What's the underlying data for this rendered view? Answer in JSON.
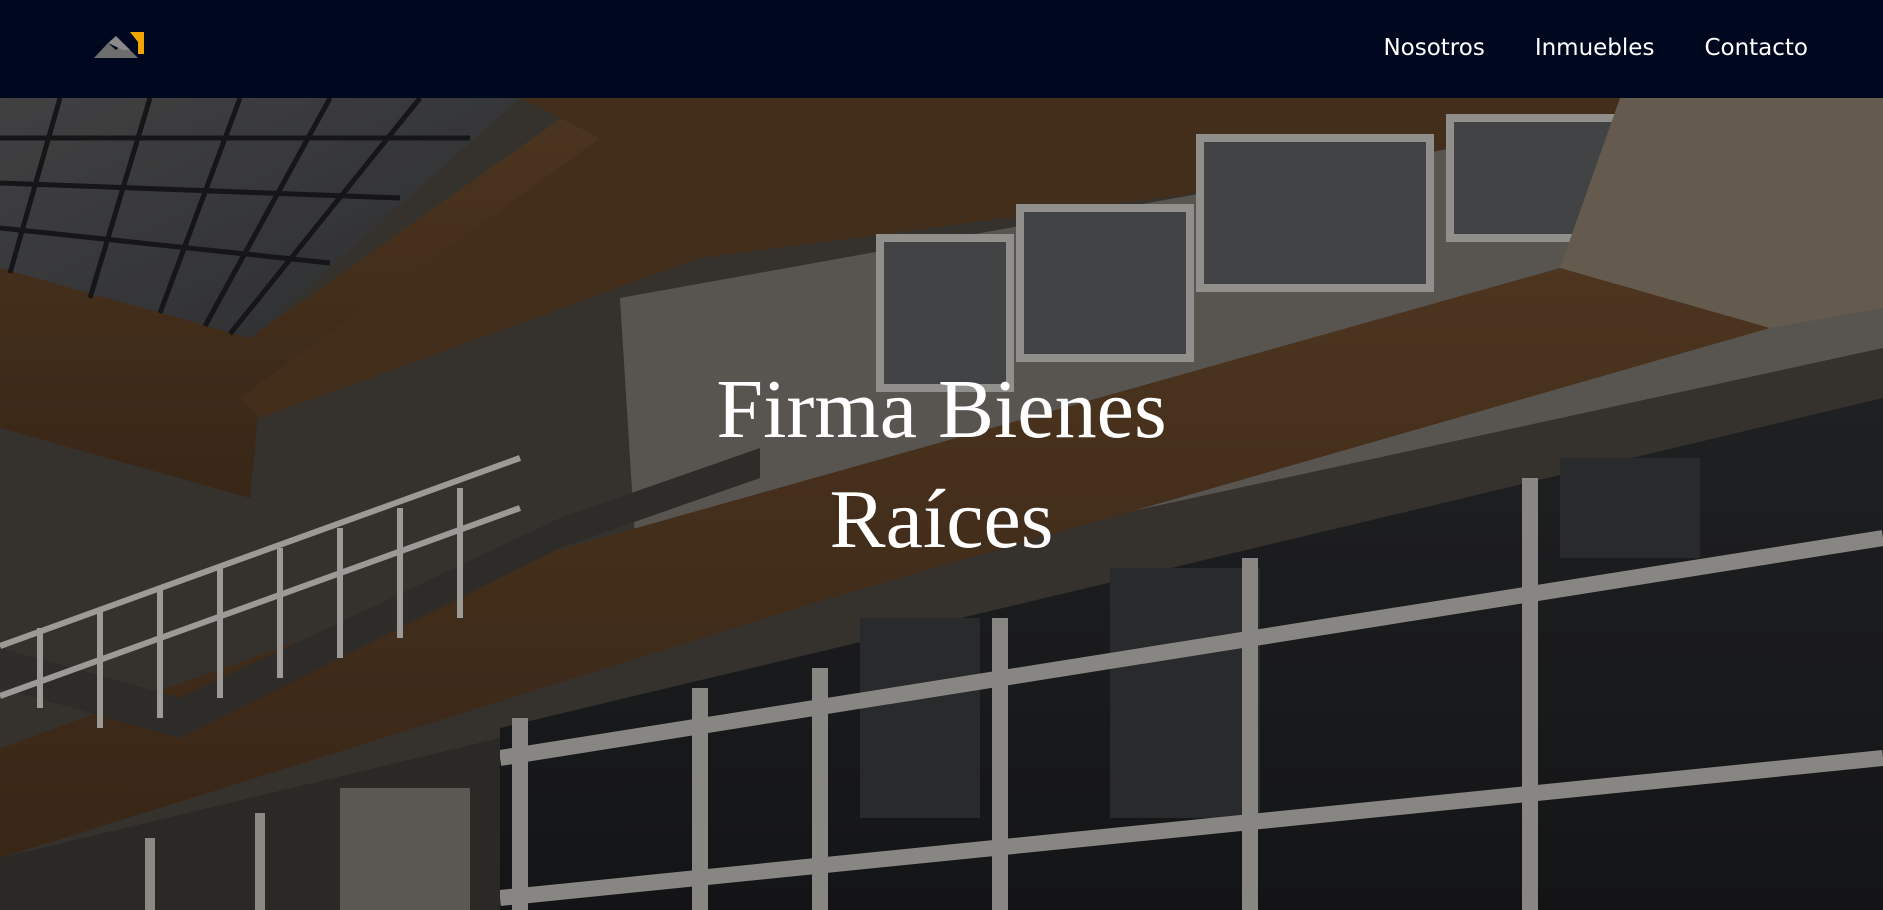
{
  "header": {
    "logo_icon": "brand-logo-icon",
    "nav": [
      {
        "label": "Nosotros"
      },
      {
        "label": "Inmuebles"
      },
      {
        "label": "Contacto"
      }
    ]
  },
  "hero": {
    "title_line1": "Firma Bienes",
    "title_line2": "Raíces",
    "background_image": "building-atrium-interior"
  },
  "colors": {
    "navbar_bg": "#000820",
    "logo_gray": "#6b6b6b",
    "logo_accent": "#f0a500",
    "text": "#ffffff"
  }
}
